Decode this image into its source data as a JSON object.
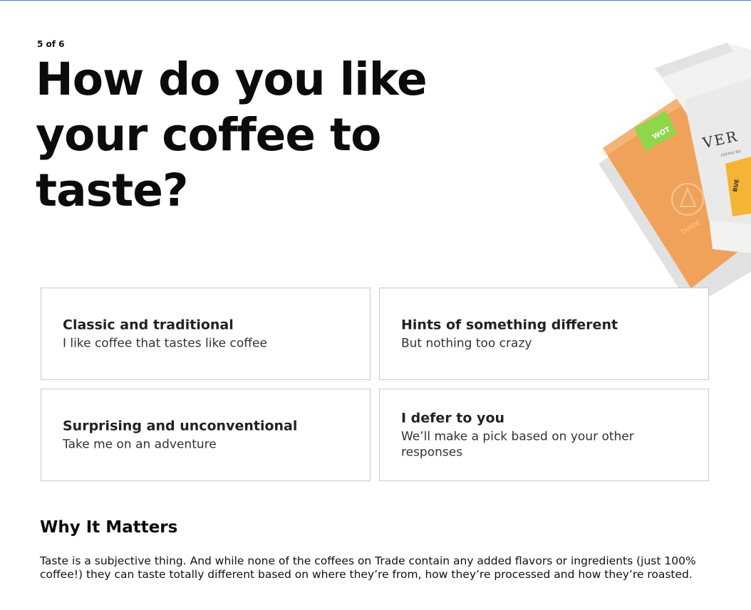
{
  "quiz": {
    "step_indicator": "5 of 6",
    "question": "How do you like your coffee to taste?"
  },
  "options": [
    {
      "title": "Classic and traditional",
      "description": "I like coffee that tastes like coffee"
    },
    {
      "title": "Hints of something different",
      "description": "But nothing too crazy"
    },
    {
      "title": "Surprising and unconventional",
      "description": "Take me on an adventure"
    },
    {
      "title": "I defer to you",
      "description": "We’ll make a pick based on your other responses"
    }
  ],
  "why": {
    "heading": "Why It Matters",
    "body": "Taste is a subjective thing. And while none of the coffees on Trade contain any added flavors or ingredients (just 100% coffee!) they can taste totally different based on where they’re from, how they’re processed and how they’re roasted."
  },
  "artwork": {
    "bag_front_brand": "VER",
    "bag_front_sub": "COFFEE RO",
    "bag_front_label": "BUE",
    "bag_back_brand": "TANDE",
    "bag_back_tag": "WOT",
    "colors": {
      "orange_bag": "#f0a25a",
      "green_tag": "#8fd64a",
      "yellow_label": "#f4b534",
      "white_bag": "#f2f2f0"
    }
  }
}
